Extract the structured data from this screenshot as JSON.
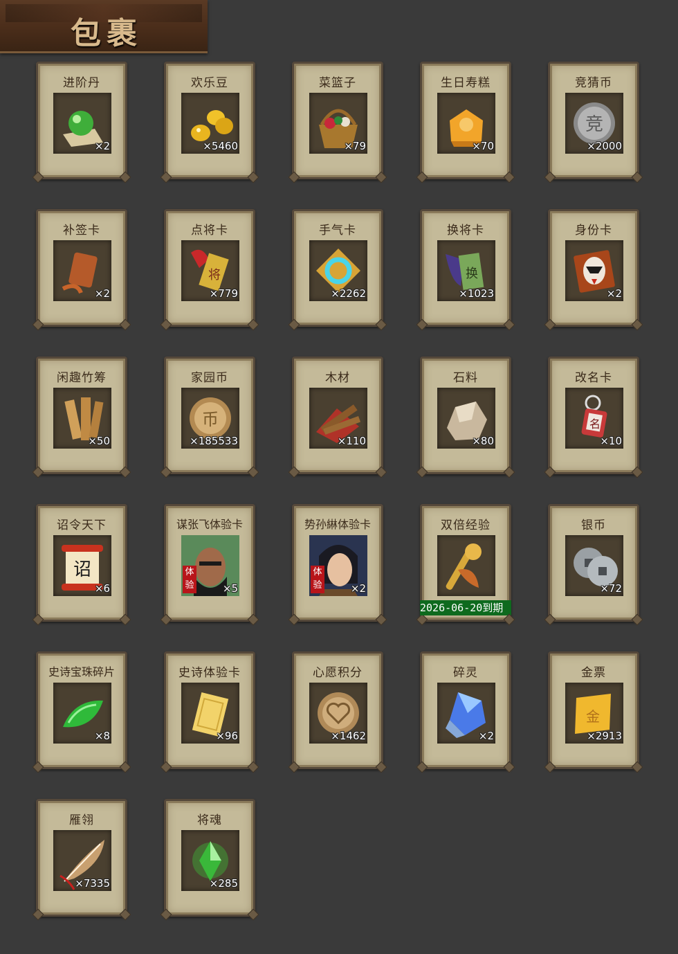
{
  "header": {
    "title": "包裹"
  },
  "items": [
    {
      "name": "进阶丹",
      "qty": "×2",
      "icon": "green-pill-icon"
    },
    {
      "name": "欢乐豆",
      "qty": "×5460",
      "icon": "gold-beans-icon"
    },
    {
      "name": "菜篮子",
      "qty": "×79",
      "icon": "basket-icon"
    },
    {
      "name": "生日寿糕",
      "qty": "×70",
      "icon": "birthday-cake-icon"
    },
    {
      "name": "竞猜币",
      "qty": "×2000",
      "icon": "silver-coin-icon"
    },
    {
      "name": "补签卡",
      "qty": "×2",
      "icon": "signin-card-icon"
    },
    {
      "name": "点将卡",
      "qty": "×779",
      "icon": "general-card-icon"
    },
    {
      "name": "手气卡",
      "qty": "×2262",
      "icon": "luck-card-icon"
    },
    {
      "name": "换将卡",
      "qty": "×1023",
      "icon": "swap-card-icon"
    },
    {
      "name": "身份卡",
      "qty": "×2",
      "icon": "identity-card-icon"
    },
    {
      "name": "闲趣竹筹",
      "qty": "×50",
      "icon": "bamboo-tally-icon"
    },
    {
      "name": "家园币",
      "qty": "×185533",
      "icon": "home-coin-icon"
    },
    {
      "name": "木材",
      "qty": "×110",
      "icon": "wood-icon"
    },
    {
      "name": "石料",
      "qty": "×80",
      "icon": "stone-icon"
    },
    {
      "name": "改名卡",
      "qty": "×10",
      "icon": "rename-card-icon"
    },
    {
      "name": "诏令天下",
      "qty": "×6",
      "icon": "scroll-icon"
    },
    {
      "name": "谋张飞体验卡",
      "qty": "×5",
      "icon": "zhangfei-portrait-icon",
      "tag": "体验"
    },
    {
      "name": "势孙綝体验卡",
      "qty": "×2",
      "icon": "sunlin-portrait-icon",
      "tag": "体验"
    },
    {
      "name": "双倍经验",
      "qty": "",
      "icon": "ruyi-scepter-icon",
      "expire": "2026-06-20到期"
    },
    {
      "name": "银币",
      "qty": "×72",
      "icon": "silver-coins-icon"
    },
    {
      "name": "史诗宝珠碎片",
      "qty": "×8",
      "icon": "green-shard-icon"
    },
    {
      "name": "史诗体验卡",
      "qty": "×96",
      "icon": "gold-card-icon"
    },
    {
      "name": "心愿积分",
      "qty": "×1462",
      "icon": "heart-coin-icon"
    },
    {
      "name": "碎灵",
      "qty": "×2",
      "icon": "blue-crystal-icon"
    },
    {
      "name": "金票",
      "qty": "×2913",
      "icon": "gold-ticket-icon"
    },
    {
      "name": "雁翎",
      "qty": "×7335",
      "icon": "feather-icon"
    },
    {
      "name": "将魂",
      "qty": "×285",
      "icon": "green-crystal-icon"
    }
  ],
  "colors": {
    "background": "#3a3a3a",
    "card": "#c4ba99",
    "expire_bar": "#0e6a1e",
    "trial_tag": "#b8151a"
  }
}
